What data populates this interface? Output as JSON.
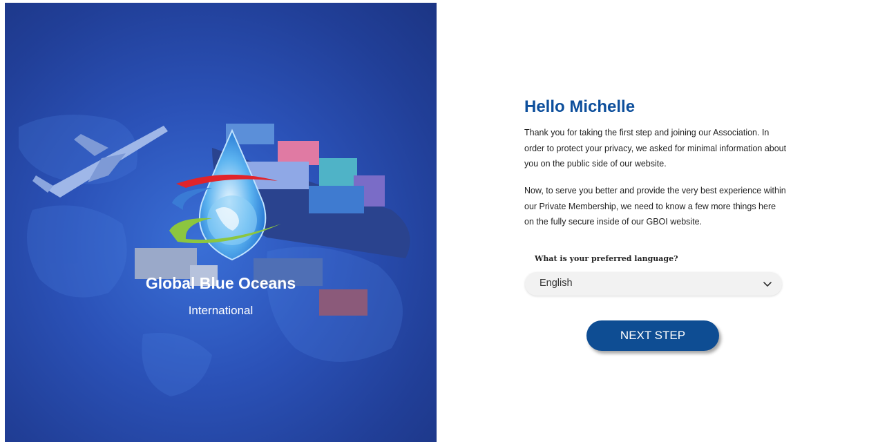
{
  "brand": {
    "name": "Global Blue Oceans",
    "tagline": "International"
  },
  "welcome": {
    "greeting": "Hello Michelle",
    "paragraph1": "Thank you for taking the first step and joining our Association. In order to protect your privacy, we asked for minimal information about you on the public side of our website.",
    "paragraph2": "Now, to serve you better and provide the very best experience within our Private Membership, we need to know a few more things here on the fully secure inside of our GBOI website."
  },
  "language": {
    "label": "What is your preferred language?",
    "selected": "English"
  },
  "actions": {
    "next_label": "NEXT STEP"
  },
  "colors": {
    "panel_blue": "#2b52b8",
    "heading_blue": "#0d4f9c",
    "button_blue": "#0e4d93",
    "swoosh_red": "#e1242a",
    "swoosh_blue": "#3a7bd5",
    "swoosh_green": "#8cc63f"
  },
  "icons": {
    "language_dropdown": "chevron-down-icon",
    "logo": "water-drop-globe-icon"
  }
}
